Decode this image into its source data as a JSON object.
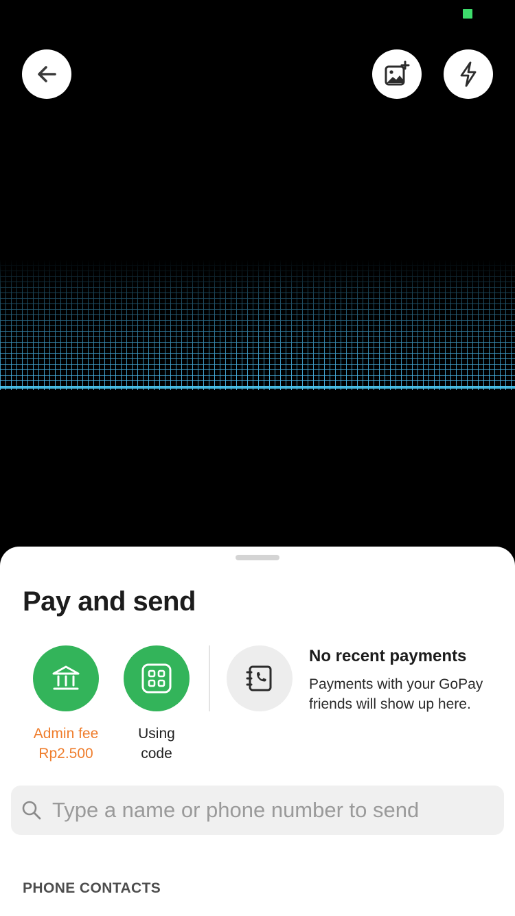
{
  "camera": {
    "back_icon": "arrow-left-icon",
    "gallery_icon": "image-plus-icon",
    "flash_icon": "lightning-icon",
    "status_dot_color": "#3ddc6b",
    "scan_color": "#4cc6f0"
  },
  "sheet": {
    "title": "Pay and send",
    "actions": [
      {
        "label_line1": "Admin fee",
        "label_line2": "Rp2.500",
        "icon": "bank-icon",
        "color": "#33b45a",
        "label_color": "#ef7d2c"
      },
      {
        "label_line1": "Using",
        "label_line2": "code",
        "icon": "qr-grid-icon",
        "color": "#33b45a"
      }
    ],
    "recent": {
      "icon": "phonebook-icon",
      "title": "No recent payments",
      "description": "Payments with your GoPay friends will show up here."
    },
    "search": {
      "placeholder": "Type a name or phone number to send",
      "value": ""
    },
    "section_label": "PHONE CONTACTS"
  }
}
